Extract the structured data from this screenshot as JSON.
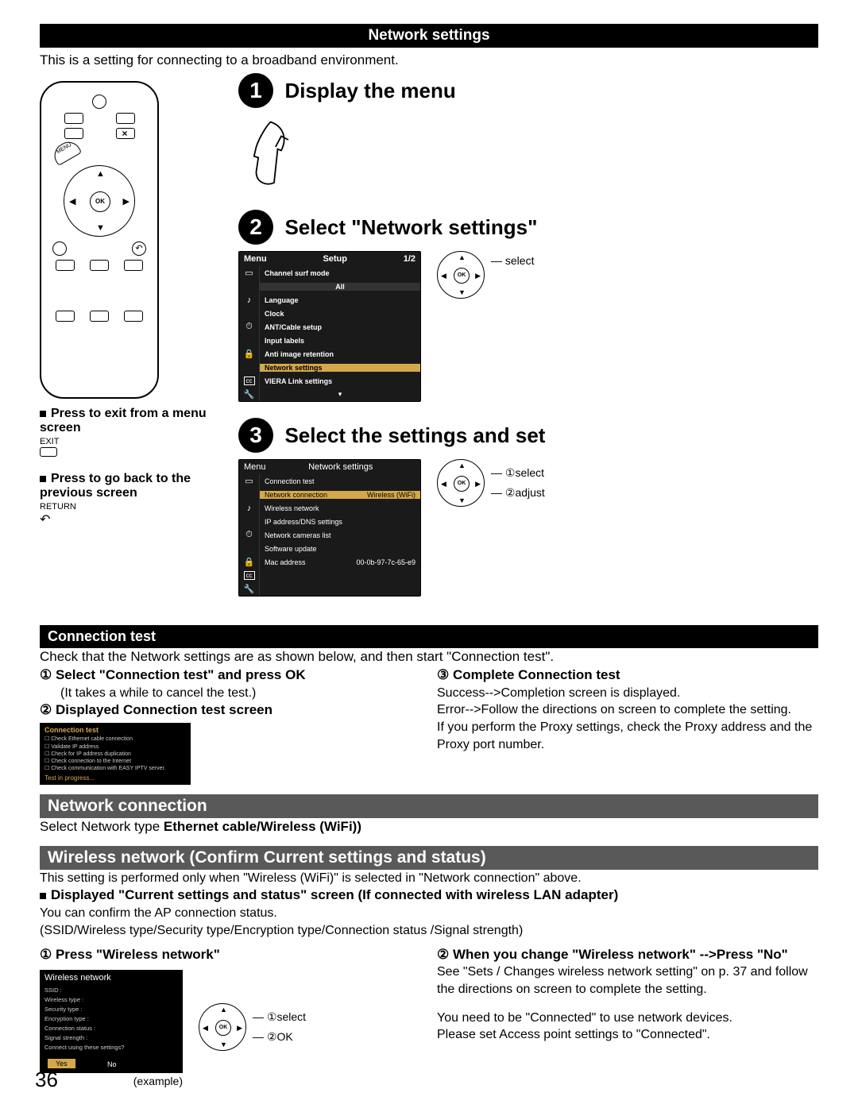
{
  "header": "Network settings",
  "intro": "This is a setting for connecting to a broadband environment.",
  "step1": {
    "num": "1",
    "title": "Display the menu"
  },
  "step2": {
    "num": "2",
    "title": "Select \"Network settings\"",
    "menu_title": "Menu",
    "menu_tab": "Setup",
    "menu_page": "1/2",
    "items": {
      "channel_surf": "Channel surf mode",
      "all": "All",
      "language": "Language",
      "clock": "Clock",
      "ant": "ANT/Cable setup",
      "input_labels": "Input labels",
      "anti": "Anti image retention",
      "network": "Network settings",
      "viera": "VIERA Link settings"
    },
    "label_select": "select"
  },
  "step3": {
    "num": "3",
    "title": "Select the settings and set",
    "menu_title": "Menu",
    "menu_tab": "Network settings",
    "items": {
      "conn_test": "Connection test",
      "net_conn": "Network connection",
      "net_conn_val": "Wireless (WiFi)",
      "wireless": "Wireless network",
      "ip": "IP address/DNS settings",
      "cams": "Network cameras list",
      "software": "Software update",
      "mac": "Mac address",
      "mac_val": "00-0b-97-7c-65-e9"
    },
    "label_select": "①select",
    "label_adjust": "②adjust"
  },
  "remote_notes": {
    "exit_title": "Press to exit from a menu screen",
    "exit_label": "EXIT",
    "back_title": "Press to go back to the previous screen",
    "return_label": "RETURN",
    "ok": "OK",
    "menu": "MENU"
  },
  "conn_test": {
    "header": "Connection test",
    "intro": "Check that the Network settings are as shown below, and then start \"Connection test\".",
    "step1": "Select \"Connection test\" and press OK",
    "step1_note": "(It takes a while to cancel the test.)",
    "step2": "Displayed Connection test screen",
    "step3": "Complete Connection test",
    "step3_l1": "Success-->Completion screen is displayed.",
    "step3_l2": "Error-->Follow the directions on screen to complete the setting.",
    "step3_l3": "If you perform the Proxy settings, check the Proxy address and the Proxy port number.",
    "box_title": "Connection test",
    "box_rows": [
      "Check Ethernet cable connection",
      "Validate IP address",
      "Check for IP address duplication",
      "Check connection to the Internet",
      "Check communication with EASY IPTV server."
    ],
    "box_progress": "Test in progress..."
  },
  "net_conn": {
    "header": "Network connection",
    "text": "Select Network type ",
    "bold": "Ethernet cable/Wireless (WiFi))"
  },
  "wireless": {
    "header": "Wireless network (Confirm Current settings and status)",
    "l1": "This setting is performed only when \"Wireless (WiFi)\" is selected in \"Network connection\" above.",
    "l2": "Displayed \"Current settings and status\" screen (If connected with wireless LAN adapter)",
    "l3": "You can confirm the AP connection status.",
    "l4": "(SSID/Wireless type/Security type/Encryption type/Connection status /Signal strength)",
    "step1": "Press \"Wireless network\"",
    "step2": "When you change \"Wireless network\" -->Press \"No\"",
    "r1": "See \"Sets / Changes wireless network setting\" on p. 37 and follow the directions on screen to complete the setting.",
    "r2": "You need to be \"Connected\" to use network devices.",
    "r3": "Please set Access point settings to \"Connected\".",
    "box_title": "Wireless network",
    "box_rows": [
      "SSID :",
      "Wireless type :",
      "Security type :",
      "Encryption type :",
      "Connection status :",
      "Signal strength :",
      "Connect using these settings?"
    ],
    "yes": "Yes",
    "no": "No",
    "example": "(example)",
    "label_select": "①select",
    "label_ok": "②OK"
  },
  "page": "36"
}
